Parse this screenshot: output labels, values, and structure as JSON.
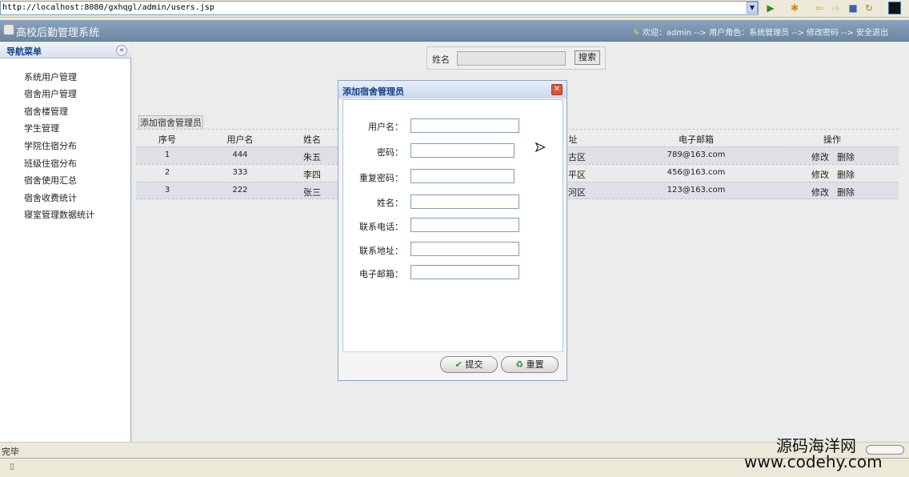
{
  "browser": {
    "url": "http://localhost:8080/gxhqgl/admin/users.jsp",
    "status": "完毕"
  },
  "header": {
    "title": "高校后勤管理系统",
    "welcome": "欢迎：admin --> 用户角色：系统管理员 --> 修改密码 --> 安全退出"
  },
  "sidebar": {
    "title": "导航菜单",
    "items": [
      {
        "label": "系统用户管理"
      },
      {
        "label": "宿舍用户管理"
      },
      {
        "label": "宿舍楼管理"
      },
      {
        "label": "学生管理"
      },
      {
        "label": "学院住宿分布"
      },
      {
        "label": "班级住宿分布"
      },
      {
        "label": "宿舍使用汇总"
      },
      {
        "label": "宿舍收费统计"
      },
      {
        "label": "寝室管理数据统计"
      }
    ]
  },
  "search": {
    "label": "姓名",
    "value": "",
    "button": "搜索"
  },
  "table": {
    "add_link": "添加宿舍管理员",
    "columns": [
      "序号",
      "用户名",
      "姓名",
      "址",
      "电子邮箱",
      "操作"
    ],
    "rows": [
      {
        "no": "1",
        "username": "444",
        "name": "朱五",
        "addr": "古区",
        "email": "789@163.com",
        "edit": "修改",
        "delete": "删除"
      },
      {
        "no": "2",
        "username": "333",
        "name": "李四",
        "addr": "平区",
        "email": "456@163.com",
        "edit": "修改",
        "delete": "删除"
      },
      {
        "no": "3",
        "username": "222",
        "name": "张三",
        "addr": "河区",
        "email": "123@163.com",
        "edit": "修改",
        "delete": "删除"
      }
    ]
  },
  "modal": {
    "title": "添加宿舍管理员",
    "fields": [
      {
        "label": "用户名：",
        "value": ""
      },
      {
        "label": "密码：",
        "value": ""
      },
      {
        "label": "重复密码：",
        "value": ""
      },
      {
        "label": "姓名：",
        "value": ""
      },
      {
        "label": "联系电话：",
        "value": ""
      },
      {
        "label": "联系地址：",
        "value": ""
      },
      {
        "label": "电子邮箱：",
        "value": ""
      }
    ],
    "submit": "提交",
    "reset": "重置"
  },
  "watermark": {
    "line1": "源码海洋网",
    "line2": "www.codehy.com"
  }
}
